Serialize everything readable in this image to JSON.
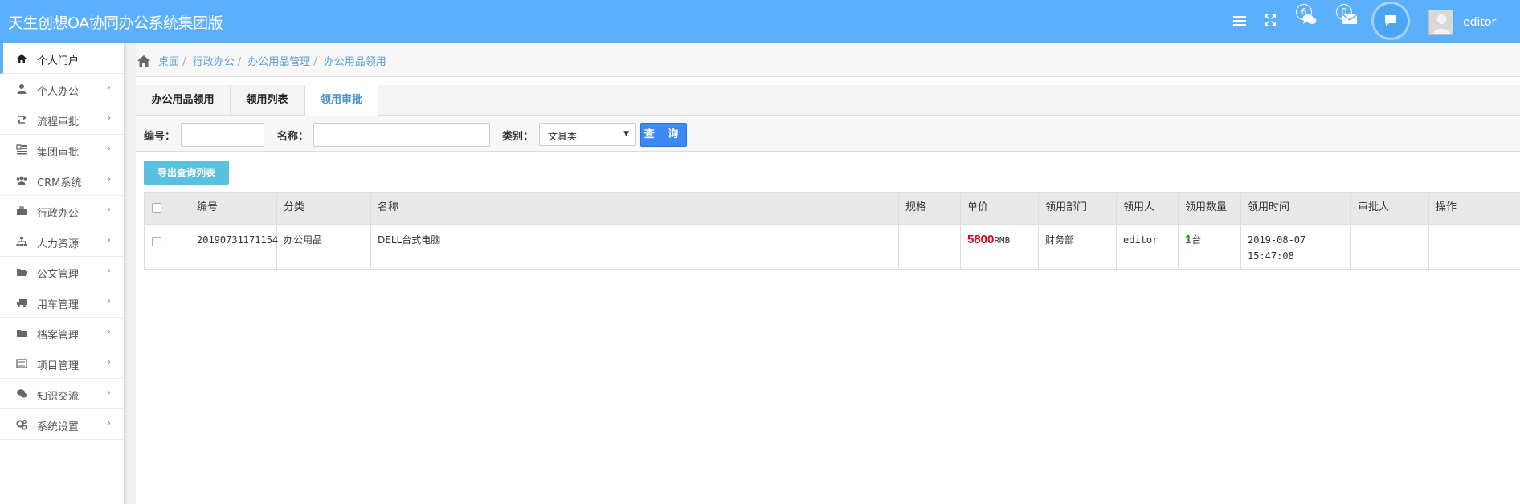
{
  "app": {
    "title": "天生创想OA协同办公系统集团版",
    "username": "editor"
  },
  "header": {
    "chat_badge": "6",
    "mail_badge": "0"
  },
  "sidebar": {
    "items": [
      {
        "label": "个人门户",
        "icon": "home-icon"
      },
      {
        "label": "个人办公",
        "icon": "user-icon"
      },
      {
        "label": "流程审批",
        "icon": "retweet-icon"
      },
      {
        "label": "集团审批",
        "icon": "grid-icon"
      },
      {
        "label": "CRM系统",
        "icon": "users-icon"
      },
      {
        "label": "行政办公",
        "icon": "briefcase-icon"
      },
      {
        "label": "人力资源",
        "icon": "sitemap-icon"
      },
      {
        "label": "公文管理",
        "icon": "folder-open-icon"
      },
      {
        "label": "用车管理",
        "icon": "truck-icon"
      },
      {
        "label": "档案管理",
        "icon": "folder-icon"
      },
      {
        "label": "项目管理",
        "icon": "list-icon"
      },
      {
        "label": "知识交流",
        "icon": "comments-icon"
      },
      {
        "label": "系统设置",
        "icon": "cogs-icon"
      }
    ]
  },
  "breadcrumb": {
    "items": [
      "桌面",
      "行政办公",
      "办公用品管理",
      "办公用品领用"
    ]
  },
  "tabs": [
    {
      "label": "办公用品领用"
    },
    {
      "label": "领用列表"
    },
    {
      "label": "领用审批"
    }
  ],
  "filter": {
    "code_label": "编号：",
    "name_label": "名称：",
    "type_label": "类别：",
    "type_value": "文具类",
    "query_button": "查 询"
  },
  "export_button": "导出查询列表",
  "table": {
    "headers": [
      "编号",
      "分类",
      "名称",
      "规格",
      "单价",
      "领用部门",
      "领用人",
      "领用数量",
      "领用时间",
      "审批人",
      "操作"
    ],
    "rows": [
      {
        "code": "20190731171154",
        "category": "办公用品",
        "name": "DELL台式电脑",
        "spec": "",
        "price": "5800",
        "price_unit": "RMB",
        "department": "财务部",
        "recipient": "editor",
        "quantity": "1",
        "quantity_unit": "台",
        "date": "2019-08-07",
        "time": "15:47:08",
        "approver": "",
        "action": ""
      }
    ]
  },
  "colors": {
    "topbar": "#5cb0fb",
    "price": "#d0021b",
    "quantity": "#2e8b22",
    "query_button": "#3f89f5",
    "export_button": "#5bc0de"
  }
}
